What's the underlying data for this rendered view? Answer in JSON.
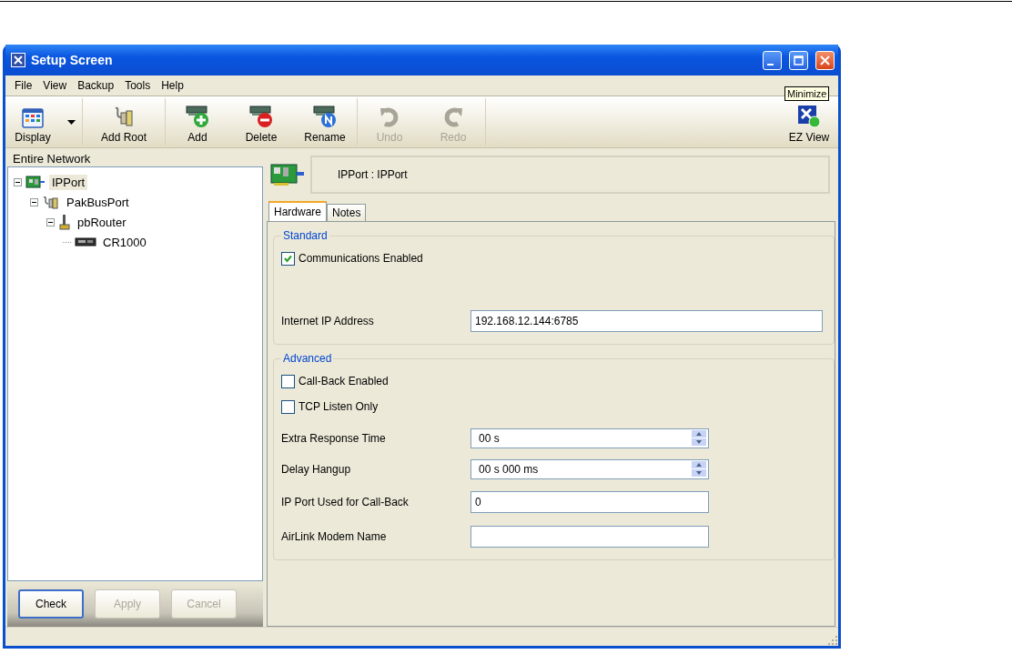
{
  "window": {
    "title": "Setup Screen"
  },
  "menu": [
    "File",
    "View",
    "Backup",
    "Tools",
    "Help"
  ],
  "toolbar": [
    {
      "kind": "display",
      "label": "Display",
      "disabled": false
    },
    {
      "kind": "add-root",
      "label": "Add Root",
      "disabled": false
    },
    {
      "kind": "add",
      "label": "Add",
      "disabled": false
    },
    {
      "kind": "delete",
      "label": "Delete",
      "disabled": false
    },
    {
      "kind": "rename",
      "label": "Rename",
      "disabled": false
    },
    {
      "kind": "undo",
      "label": "Undo",
      "disabled": true
    },
    {
      "kind": "redo",
      "label": "Redo",
      "disabled": true
    },
    {
      "kind": "ez-view",
      "label": "EZ View",
      "disabled": false
    }
  ],
  "tooltip": "Minimize",
  "tree": {
    "header": "Entire Network",
    "items": [
      {
        "kind": "ipport",
        "label": "IPPort",
        "selected": true,
        "expanded": true,
        "children": [
          {
            "kind": "pakbus",
            "label": "PakBusPort",
            "selected": false,
            "expanded": true,
            "children": [
              {
                "kind": "router",
                "label": "pbRouter",
                "selected": false,
                "expanded": true,
                "children": [
                  {
                    "kind": "logger",
                    "label": "CR1000",
                    "selected": false
                  }
                ]
              }
            ]
          }
        ]
      }
    ]
  },
  "tree_buttons": [
    {
      "label": "Check",
      "disabled": false
    },
    {
      "label": "Apply",
      "disabled": true
    },
    {
      "label": "Cancel",
      "disabled": true
    }
  ],
  "detail": {
    "heading": "IPPort : IPPort",
    "tabs": [
      {
        "label": "Hardware",
        "selected": true
      },
      {
        "label": "Notes",
        "selected": false
      }
    ],
    "groups": [
      {
        "title": "Standard",
        "rows": [
          {
            "kind": "checkbox",
            "label": "Communications Enabled",
            "checked": true
          },
          {
            "kind": "text",
            "label": "Internet IP Address",
            "value": "192.168.12.144:6785",
            "wide": true
          }
        ]
      },
      {
        "title": "Advanced",
        "rows": [
          {
            "kind": "checkbox",
            "label": "Call-Back Enabled",
            "checked": false
          },
          {
            "kind": "checkbox",
            "label": "TCP Listen Only",
            "checked": false
          },
          {
            "kind": "spinner",
            "label": "Extra Response Time",
            "value": "00 s"
          },
          {
            "kind": "spinner",
            "label": "Delay Hangup",
            "value": "00 s 000 ms"
          },
          {
            "kind": "text",
            "label": "IP Port Used for Call-Back",
            "value": "0",
            "wide": false
          },
          {
            "kind": "text",
            "label": "AirLink Modem Name",
            "value": "",
            "wide": false
          }
        ]
      }
    ]
  }
}
